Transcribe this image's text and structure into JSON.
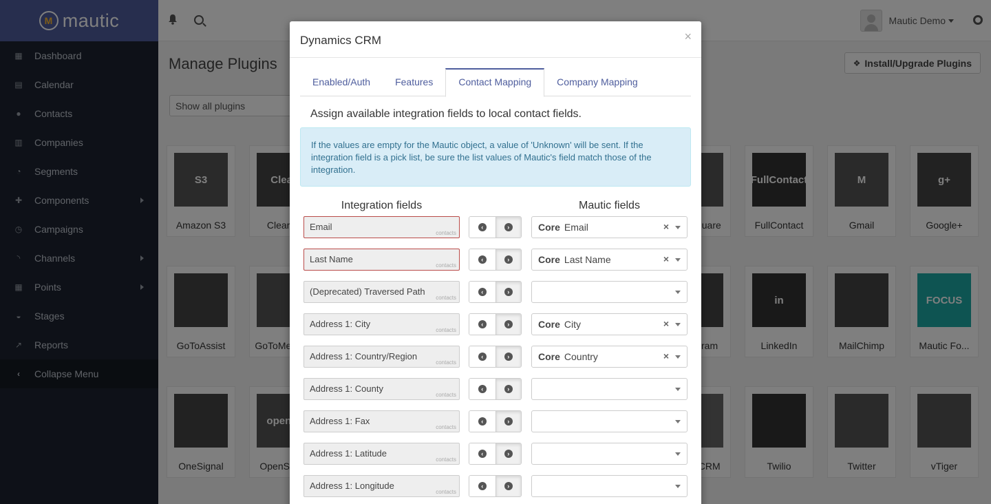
{
  "brand": {
    "name": "mautic"
  },
  "sidebar": {
    "items": [
      {
        "label": "Dashboard",
        "icon": "dashboard-icon",
        "glyph": "▦",
        "submenu": false
      },
      {
        "label": "Calendar",
        "icon": "calendar-icon",
        "glyph": "▤",
        "submenu": false
      },
      {
        "label": "Contacts",
        "icon": "user-icon",
        "glyph": "●",
        "submenu": false
      },
      {
        "label": "Companies",
        "icon": "building-icon",
        "glyph": "▥",
        "submenu": false
      },
      {
        "label": "Segments",
        "icon": "pie-chart-icon",
        "glyph": "◔",
        "submenu": false
      },
      {
        "label": "Components",
        "icon": "puzzle-icon",
        "glyph": "✚",
        "submenu": true
      },
      {
        "label": "Campaigns",
        "icon": "clock-icon",
        "glyph": "◷",
        "submenu": false
      },
      {
        "label": "Channels",
        "icon": "rss-icon",
        "glyph": "◝",
        "submenu": true
      },
      {
        "label": "Points",
        "icon": "calculator-icon",
        "glyph": "▦",
        "submenu": true
      },
      {
        "label": "Stages",
        "icon": "tachometer-icon",
        "glyph": "◒",
        "submenu": false
      },
      {
        "label": "Reports",
        "icon": "line-chart-icon",
        "glyph": "↗",
        "submenu": false
      },
      {
        "label": "Collapse Menu",
        "icon": "chevron-left-icon",
        "glyph": "‹",
        "submenu": false
      }
    ]
  },
  "topbar": {
    "user_name": "Mautic Demo"
  },
  "page": {
    "title": "Manage Plugins",
    "install_label": "Install/Upgrade Plugins",
    "filter_label": "Show all plugins",
    "tiles": [
      {
        "name": "Amazon S3",
        "logo_text": "S3",
        "color": "#555555"
      },
      {
        "name": "Clearbit",
        "logo_text": "Clear",
        "color": "#444444"
      },
      {
        "name": "Foursquare",
        "logo_text": "",
        "color": "#555555"
      },
      {
        "name": "FullContact",
        "logo_text": "FullContact",
        "color": "#333333"
      },
      {
        "name": "Gmail",
        "logo_text": "M",
        "color": "#555555"
      },
      {
        "name": "Google+",
        "logo_text": "g+",
        "color": "#444444"
      },
      {
        "name": "GoToAssist",
        "logo_text": "",
        "color": "#444444"
      },
      {
        "name": "GoToMeeting",
        "logo_text": "",
        "color": "#555555"
      },
      {
        "name": "Instagram",
        "logo_text": "",
        "color": "#444444"
      },
      {
        "name": "LinkedIn",
        "logo_text": "in",
        "color": "#333333"
      },
      {
        "name": "MailChimp",
        "logo_text": "",
        "color": "#444444"
      },
      {
        "name": "Mautic Fo...",
        "logo_text": "FOCUS",
        "color": "#1ca9a4"
      },
      {
        "name": "OneSignal",
        "logo_text": "",
        "color": "#444444"
      },
      {
        "name": "OpenStack",
        "logo_text": "openst",
        "color": "#555555"
      },
      {
        "name": "SugarCRM",
        "logo_text": "",
        "color": "#666666"
      },
      {
        "name": "Twilio",
        "logo_text": "",
        "color": "#333333"
      },
      {
        "name": "Twitter",
        "logo_text": "",
        "color": "#555555"
      },
      {
        "name": "vTiger",
        "logo_text": "",
        "color": "#555555"
      }
    ]
  },
  "modal": {
    "title": "Dynamics CRM",
    "close_label": "×",
    "tabs": [
      {
        "label": "Enabled/Auth",
        "active": false
      },
      {
        "label": "Features",
        "active": false
      },
      {
        "label": "Contact Mapping",
        "active": true
      },
      {
        "label": "Company Mapping",
        "active": false
      }
    ],
    "intro": "Assign available integration fields to local contact fields.",
    "info": "If the values are empty for the Mautic object, a value of 'Unknown' will be sent. If the integration field is a pick list, be sure the list values of Mautic's field match those of the integration.",
    "integration_header": "Integration fields",
    "mautic_header": "Mautic fields",
    "rows": [
      {
        "integration": "Email",
        "tag": "contacts",
        "required": true,
        "group": "Core",
        "mautic": "Email"
      },
      {
        "integration": "Last Name",
        "tag": "contacts",
        "required": true,
        "group": "Core",
        "mautic": "Last Name"
      },
      {
        "integration": "(Deprecated) Traversed Path",
        "tag": "contacts",
        "required": false,
        "group": "",
        "mautic": ""
      },
      {
        "integration": "Address 1: City",
        "tag": "contacts",
        "required": false,
        "group": "Core",
        "mautic": "City"
      },
      {
        "integration": "Address 1: Country/Region",
        "tag": "contacts",
        "required": false,
        "group": "Core",
        "mautic": "Country"
      },
      {
        "integration": "Address 1: County",
        "tag": "contacts",
        "required": false,
        "group": "",
        "mautic": ""
      },
      {
        "integration": "Address 1: Fax",
        "tag": "contacts",
        "required": false,
        "group": "",
        "mautic": ""
      },
      {
        "integration": "Address 1: Latitude",
        "tag": "contacts",
        "required": false,
        "group": "",
        "mautic": ""
      },
      {
        "integration": "Address 1: Longitude",
        "tag": "contacts",
        "required": false,
        "group": "",
        "mautic": ""
      }
    ]
  },
  "colors": {
    "sidebar": "#1c2330",
    "brand": "#4e5d9d",
    "accent": "#4e5d9d",
    "info_bg": "#d9edf7",
    "error": "#b94a48"
  }
}
